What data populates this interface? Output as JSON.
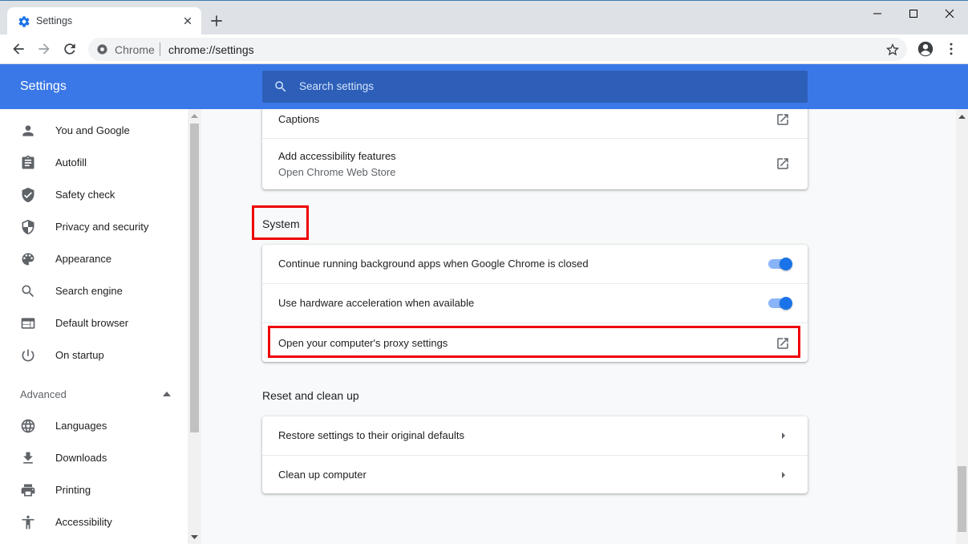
{
  "browser": {
    "tab_title": "Settings",
    "omnibox_chip": "Chrome",
    "url": "chrome://settings"
  },
  "header": {
    "title": "Settings",
    "search_placeholder": "Search settings"
  },
  "sidebar": {
    "items": [
      {
        "label": "You and Google",
        "icon": "person-icon"
      },
      {
        "label": "Autofill",
        "icon": "clipboard-icon"
      },
      {
        "label": "Safety check",
        "icon": "shield-check-icon"
      },
      {
        "label": "Privacy and security",
        "icon": "shield-icon"
      },
      {
        "label": "Appearance",
        "icon": "palette-icon"
      },
      {
        "label": "Search engine",
        "icon": "search-icon"
      },
      {
        "label": "Default browser",
        "icon": "browser-icon"
      },
      {
        "label": "On startup",
        "icon": "power-icon"
      }
    ],
    "advanced_label": "Advanced",
    "advanced_items": [
      {
        "label": "Languages",
        "icon": "globe-icon"
      },
      {
        "label": "Downloads",
        "icon": "download-icon"
      },
      {
        "label": "Printing",
        "icon": "printer-icon"
      },
      {
        "label": "Accessibility",
        "icon": "accessibility-icon"
      }
    ]
  },
  "accessibility_card": {
    "captions": "Captions",
    "add_features": "Add accessibility features",
    "add_features_sub": "Open Chrome Web Store"
  },
  "system": {
    "title": "System",
    "background_apps": "Continue running background apps when Google Chrome is closed",
    "background_apps_on": true,
    "hw_accel": "Use hardware acceleration when available",
    "hw_accel_on": true,
    "proxy": "Open your computer's proxy settings"
  },
  "reset": {
    "title": "Reset and clean up",
    "restore": "Restore settings to their original defaults",
    "cleanup": "Clean up computer"
  },
  "colors": {
    "header_blue": "#3b78e7",
    "toggle_blue": "#1a73e8",
    "highlight_red": "#e00000"
  }
}
